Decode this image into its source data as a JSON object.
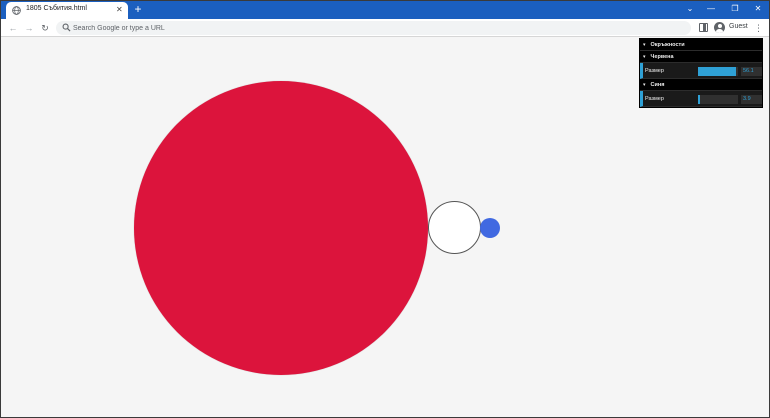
{
  "browser": {
    "tab_title": "1805 Cъбития.html",
    "tab_close": "✕",
    "new_tab": "+",
    "window_controls": {
      "dropdown": "⌄",
      "minimize": "—",
      "restore": "❐",
      "close": "✕"
    },
    "nav": {
      "back": "←",
      "forward": "→",
      "reload": "↻"
    },
    "omnibox_placeholder": "Search Google or type a URL",
    "profile_name": "Guest",
    "menu": "⋮",
    "theme_color": "#1b5fbf"
  },
  "scene": {
    "circles": [
      {
        "name": "red",
        "color": "#dc143c"
      },
      {
        "name": "white",
        "color": "#ffffff"
      },
      {
        "name": "blue",
        "color": "#4169e1"
      }
    ]
  },
  "gui": {
    "root_folder": "Окръжности",
    "folders": [
      {
        "title": "Червена",
        "param_label": "Размер",
        "value": "56.1",
        "fill_fraction": 0.95
      },
      {
        "title": "Синя",
        "param_label": "Размер",
        "value": "3.9",
        "fill_fraction": 0.05
      }
    ],
    "chevron": "▾",
    "accent_color": "#2fa1d6"
  }
}
